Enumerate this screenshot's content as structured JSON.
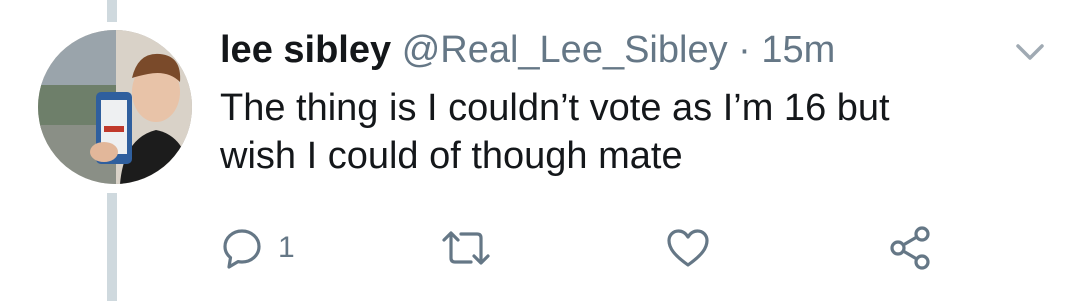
{
  "tweet": {
    "name": "lee sibley",
    "handle": "@Real_Lee_Sibley",
    "separator": "·",
    "time": "15m",
    "text_line1": "The thing is I couldn’t vote as I’m 16 but",
    "text_line2": "wish I could of though mate",
    "reply_count": "1"
  },
  "icons": {
    "caret": "chevron-down-icon",
    "reply": "reply-icon",
    "retweet": "retweet-icon",
    "like": "heart-icon",
    "share": "share-icon"
  },
  "colors": {
    "text": "#14171a",
    "secondary": "#657786",
    "thread_line": "#cfd9de"
  }
}
